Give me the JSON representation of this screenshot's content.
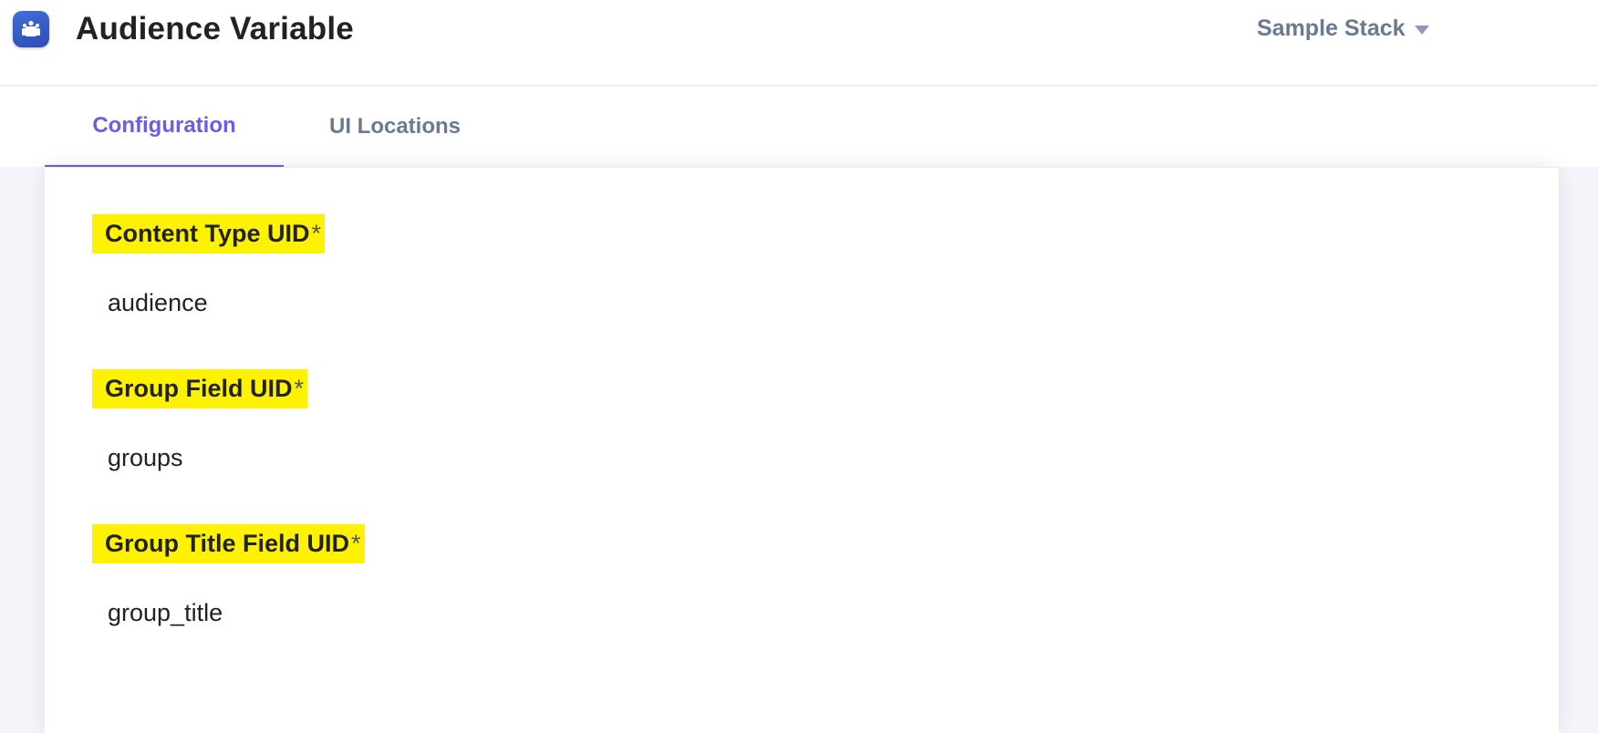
{
  "header": {
    "title": "Audience Variable",
    "app_icon": "audience-group-icon",
    "stack": {
      "label": "Sample Stack",
      "caret_icon": "caret-down-icon"
    }
  },
  "tabs": [
    {
      "label": "Configuration",
      "active": true
    },
    {
      "label": "UI Locations",
      "active": false
    }
  ],
  "fields": [
    {
      "label": "Content Type UID",
      "required_mark": "*",
      "value": "audience"
    },
    {
      "label": "Group Field UID",
      "required_mark": "*",
      "value": "groups"
    },
    {
      "label": "Group Title Field UID",
      "required_mark": "*",
      "value": "group_title"
    }
  ],
  "colors": {
    "accent": "#6c5ce7",
    "highlight": "#fff200",
    "muted_text": "#6b7a94",
    "icon_blue": "#2f4bb7"
  }
}
